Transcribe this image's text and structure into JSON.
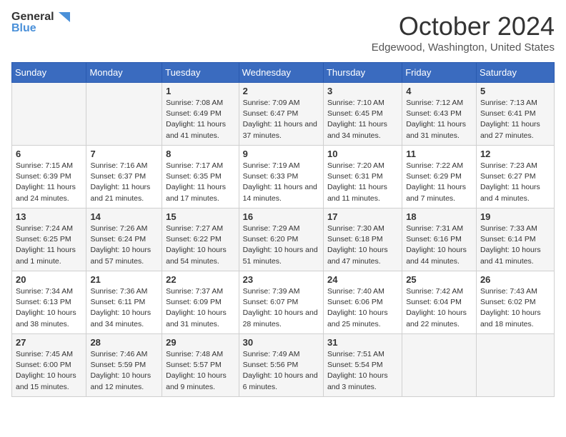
{
  "header": {
    "logo_general": "General",
    "logo_blue": "Blue",
    "month": "October 2024",
    "location": "Edgewood, Washington, United States"
  },
  "days_of_week": [
    "Sunday",
    "Monday",
    "Tuesday",
    "Wednesday",
    "Thursday",
    "Friday",
    "Saturday"
  ],
  "weeks": [
    [
      {
        "day": "",
        "info": ""
      },
      {
        "day": "",
        "info": ""
      },
      {
        "day": "1",
        "info": "Sunrise: 7:08 AM\nSunset: 6:49 PM\nDaylight: 11 hours and 41 minutes."
      },
      {
        "day": "2",
        "info": "Sunrise: 7:09 AM\nSunset: 6:47 PM\nDaylight: 11 hours and 37 minutes."
      },
      {
        "day": "3",
        "info": "Sunrise: 7:10 AM\nSunset: 6:45 PM\nDaylight: 11 hours and 34 minutes."
      },
      {
        "day": "4",
        "info": "Sunrise: 7:12 AM\nSunset: 6:43 PM\nDaylight: 11 hours and 31 minutes."
      },
      {
        "day": "5",
        "info": "Sunrise: 7:13 AM\nSunset: 6:41 PM\nDaylight: 11 hours and 27 minutes."
      }
    ],
    [
      {
        "day": "6",
        "info": "Sunrise: 7:15 AM\nSunset: 6:39 PM\nDaylight: 11 hours and 24 minutes."
      },
      {
        "day": "7",
        "info": "Sunrise: 7:16 AM\nSunset: 6:37 PM\nDaylight: 11 hours and 21 minutes."
      },
      {
        "day": "8",
        "info": "Sunrise: 7:17 AM\nSunset: 6:35 PM\nDaylight: 11 hours and 17 minutes."
      },
      {
        "day": "9",
        "info": "Sunrise: 7:19 AM\nSunset: 6:33 PM\nDaylight: 11 hours and 14 minutes."
      },
      {
        "day": "10",
        "info": "Sunrise: 7:20 AM\nSunset: 6:31 PM\nDaylight: 11 hours and 11 minutes."
      },
      {
        "day": "11",
        "info": "Sunrise: 7:22 AM\nSunset: 6:29 PM\nDaylight: 11 hours and 7 minutes."
      },
      {
        "day": "12",
        "info": "Sunrise: 7:23 AM\nSunset: 6:27 PM\nDaylight: 11 hours and 4 minutes."
      }
    ],
    [
      {
        "day": "13",
        "info": "Sunrise: 7:24 AM\nSunset: 6:25 PM\nDaylight: 11 hours and 1 minute."
      },
      {
        "day": "14",
        "info": "Sunrise: 7:26 AM\nSunset: 6:24 PM\nDaylight: 10 hours and 57 minutes."
      },
      {
        "day": "15",
        "info": "Sunrise: 7:27 AM\nSunset: 6:22 PM\nDaylight: 10 hours and 54 minutes."
      },
      {
        "day": "16",
        "info": "Sunrise: 7:29 AM\nSunset: 6:20 PM\nDaylight: 10 hours and 51 minutes."
      },
      {
        "day": "17",
        "info": "Sunrise: 7:30 AM\nSunset: 6:18 PM\nDaylight: 10 hours and 47 minutes."
      },
      {
        "day": "18",
        "info": "Sunrise: 7:31 AM\nSunset: 6:16 PM\nDaylight: 10 hours and 44 minutes."
      },
      {
        "day": "19",
        "info": "Sunrise: 7:33 AM\nSunset: 6:14 PM\nDaylight: 10 hours and 41 minutes."
      }
    ],
    [
      {
        "day": "20",
        "info": "Sunrise: 7:34 AM\nSunset: 6:13 PM\nDaylight: 10 hours and 38 minutes."
      },
      {
        "day": "21",
        "info": "Sunrise: 7:36 AM\nSunset: 6:11 PM\nDaylight: 10 hours and 34 minutes."
      },
      {
        "day": "22",
        "info": "Sunrise: 7:37 AM\nSunset: 6:09 PM\nDaylight: 10 hours and 31 minutes."
      },
      {
        "day": "23",
        "info": "Sunrise: 7:39 AM\nSunset: 6:07 PM\nDaylight: 10 hours and 28 minutes."
      },
      {
        "day": "24",
        "info": "Sunrise: 7:40 AM\nSunset: 6:06 PM\nDaylight: 10 hours and 25 minutes."
      },
      {
        "day": "25",
        "info": "Sunrise: 7:42 AM\nSunset: 6:04 PM\nDaylight: 10 hours and 22 minutes."
      },
      {
        "day": "26",
        "info": "Sunrise: 7:43 AM\nSunset: 6:02 PM\nDaylight: 10 hours and 18 minutes."
      }
    ],
    [
      {
        "day": "27",
        "info": "Sunrise: 7:45 AM\nSunset: 6:00 PM\nDaylight: 10 hours and 15 minutes."
      },
      {
        "day": "28",
        "info": "Sunrise: 7:46 AM\nSunset: 5:59 PM\nDaylight: 10 hours and 12 minutes."
      },
      {
        "day": "29",
        "info": "Sunrise: 7:48 AM\nSunset: 5:57 PM\nDaylight: 10 hours and 9 minutes."
      },
      {
        "day": "30",
        "info": "Sunrise: 7:49 AM\nSunset: 5:56 PM\nDaylight: 10 hours and 6 minutes."
      },
      {
        "day": "31",
        "info": "Sunrise: 7:51 AM\nSunset: 5:54 PM\nDaylight: 10 hours and 3 minutes."
      },
      {
        "day": "",
        "info": ""
      },
      {
        "day": "",
        "info": ""
      }
    ]
  ]
}
